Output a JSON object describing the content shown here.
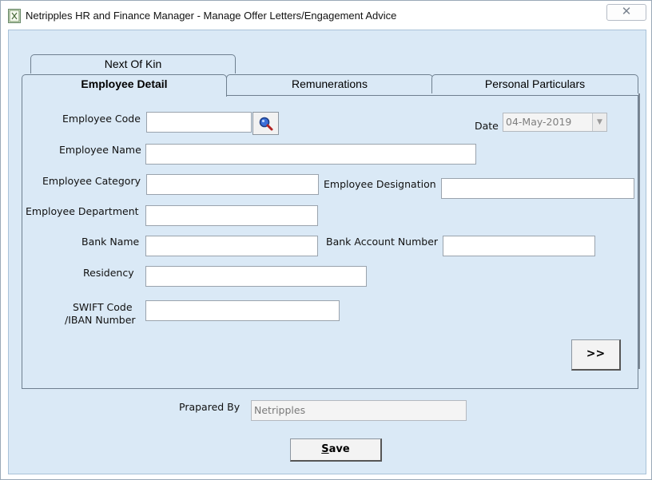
{
  "window": {
    "title": "Netripples HR and Finance Manager - Manage Offer Letters/Engagement Advice",
    "close_glyph": "✕"
  },
  "tabs": {
    "next_of_kin": "Next Of Kin",
    "employee_detail": "Employee Detail",
    "remunerations": "Remunerations",
    "personal_particulars": "Personal Particulars"
  },
  "form": {
    "employee_code": {
      "label": "Employee Code",
      "value": ""
    },
    "date": {
      "label": "Date",
      "value": "04-May-2019"
    },
    "employee_name": {
      "label": "Employee Name",
      "value": ""
    },
    "employee_category": {
      "label": "Employee Category",
      "value": ""
    },
    "employee_designation": {
      "label": "Employee Designation",
      "value": ""
    },
    "employee_department": {
      "label": "Employee Department",
      "value": ""
    },
    "bank_name": {
      "label": "Bank Name",
      "value": ""
    },
    "bank_account_number": {
      "label": "Bank Account Number",
      "value": ""
    },
    "residency": {
      "label": "Residency",
      "value": ""
    },
    "swift_line1": "SWIFT Code",
    "swift_line2": "/IBAN Number",
    "swift_value": "",
    "next_label": ">>"
  },
  "footer": {
    "prepared_by_label": "Prapared By",
    "prepared_by_value": "Netripples",
    "save_first": "S",
    "save_rest": "ave"
  },
  "icons": {
    "app": "app-icon",
    "search": "magnifier-search-icon",
    "dropdown": "chevron-down-icon"
  },
  "colors": {
    "client_background": "#dae9f6",
    "tab_border": "#6e7f8f"
  }
}
